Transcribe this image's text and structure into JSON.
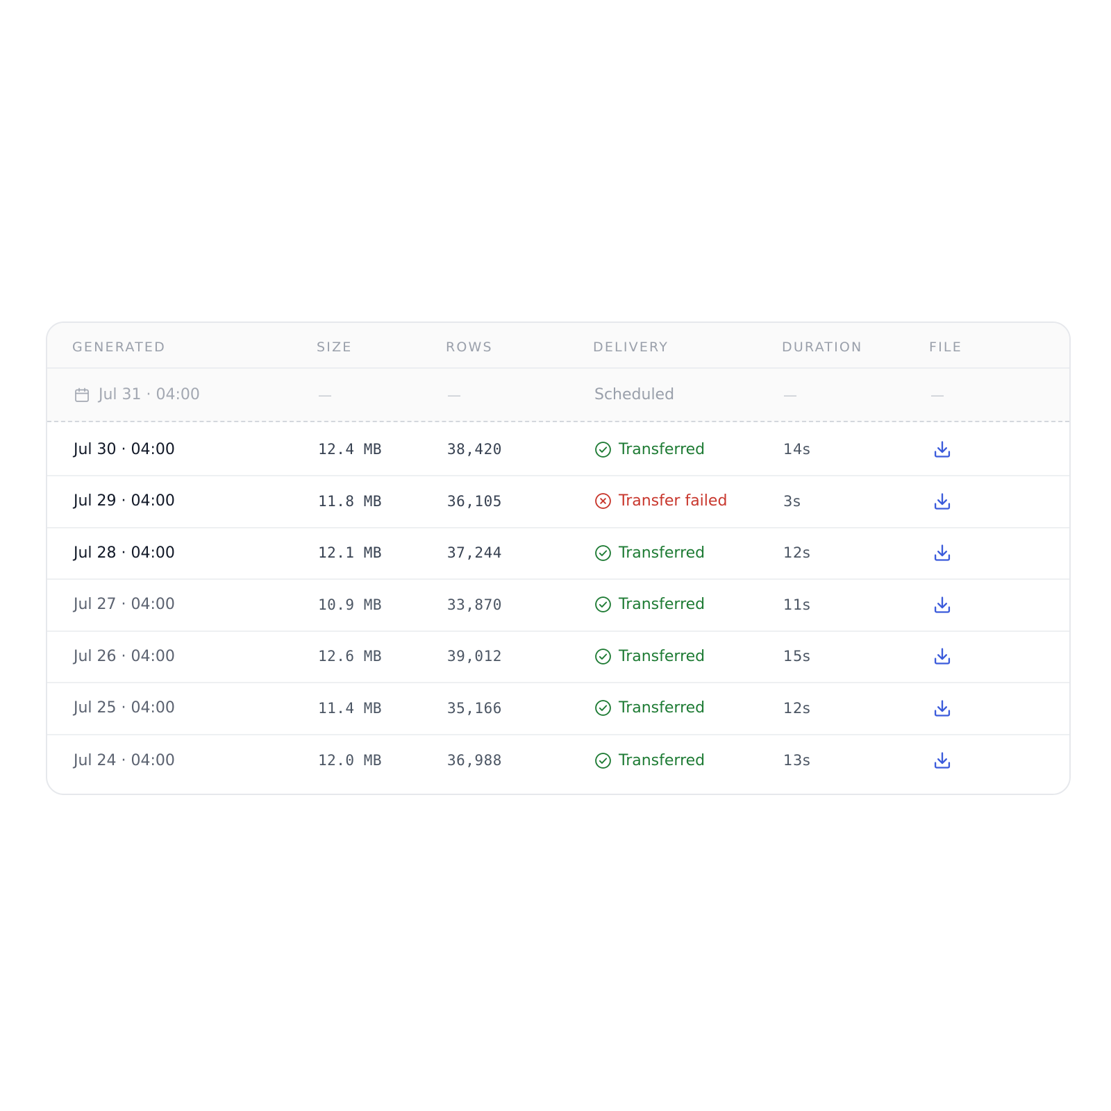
{
  "columns": {
    "generated": "GENERATED",
    "size": "SIZE",
    "rows": "ROWS",
    "delivery": "DELIVERY",
    "duration": "DURATION",
    "file": "FILE"
  },
  "scheduled": {
    "generated": "Jul 31 · 04:00",
    "size": "—",
    "rows": "—",
    "delivery": "Scheduled",
    "duration": "—",
    "file": "—",
    "icon": "calendar-icon"
  },
  "runs": [
    {
      "generated": "Jul 30 · 04:00",
      "size": "12.4 MB",
      "rows": "38,420",
      "delivery": "Transferred",
      "status": "success",
      "duration": "14s",
      "file_icon": "download-icon"
    },
    {
      "generated": "Jul 29 · 04:00",
      "size": "11.8 MB",
      "rows": "36,105",
      "delivery": "Transfer failed",
      "status": "failed",
      "duration": "3s",
      "file_icon": "download-icon"
    },
    {
      "generated": "Jul 28 · 04:00",
      "size": "12.1 MB",
      "rows": "37,244",
      "delivery": "Transferred",
      "status": "success",
      "duration": "12s",
      "file_icon": "download-icon"
    },
    {
      "generated": "Jul 27 · 04:00",
      "size": "10.9 MB",
      "rows": "33,870",
      "delivery": "Transferred",
      "status": "success",
      "duration": "11s",
      "file_icon": "download-icon"
    },
    {
      "generated": "Jul 26 · 04:00",
      "size": "12.6 MB",
      "rows": "39,012",
      "delivery": "Transferred",
      "status": "success",
      "duration": "15s",
      "file_icon": "download-icon"
    },
    {
      "generated": "Jul 25 · 04:00",
      "size": "11.4 MB",
      "rows": "35,166",
      "delivery": "Transferred",
      "status": "success",
      "duration": "12s",
      "file_icon": "download-icon"
    },
    {
      "generated": "Jul 24 · 04:00",
      "size": "12.0 MB",
      "rows": "36,988",
      "delivery": "Transferred",
      "status": "success",
      "duration": "13s",
      "file_icon": "download-icon"
    }
  ],
  "colors": {
    "success": "#1e7b34",
    "failed": "#c8372d",
    "download": "#3b5bdb",
    "header_text": "#9aa0ab"
  }
}
